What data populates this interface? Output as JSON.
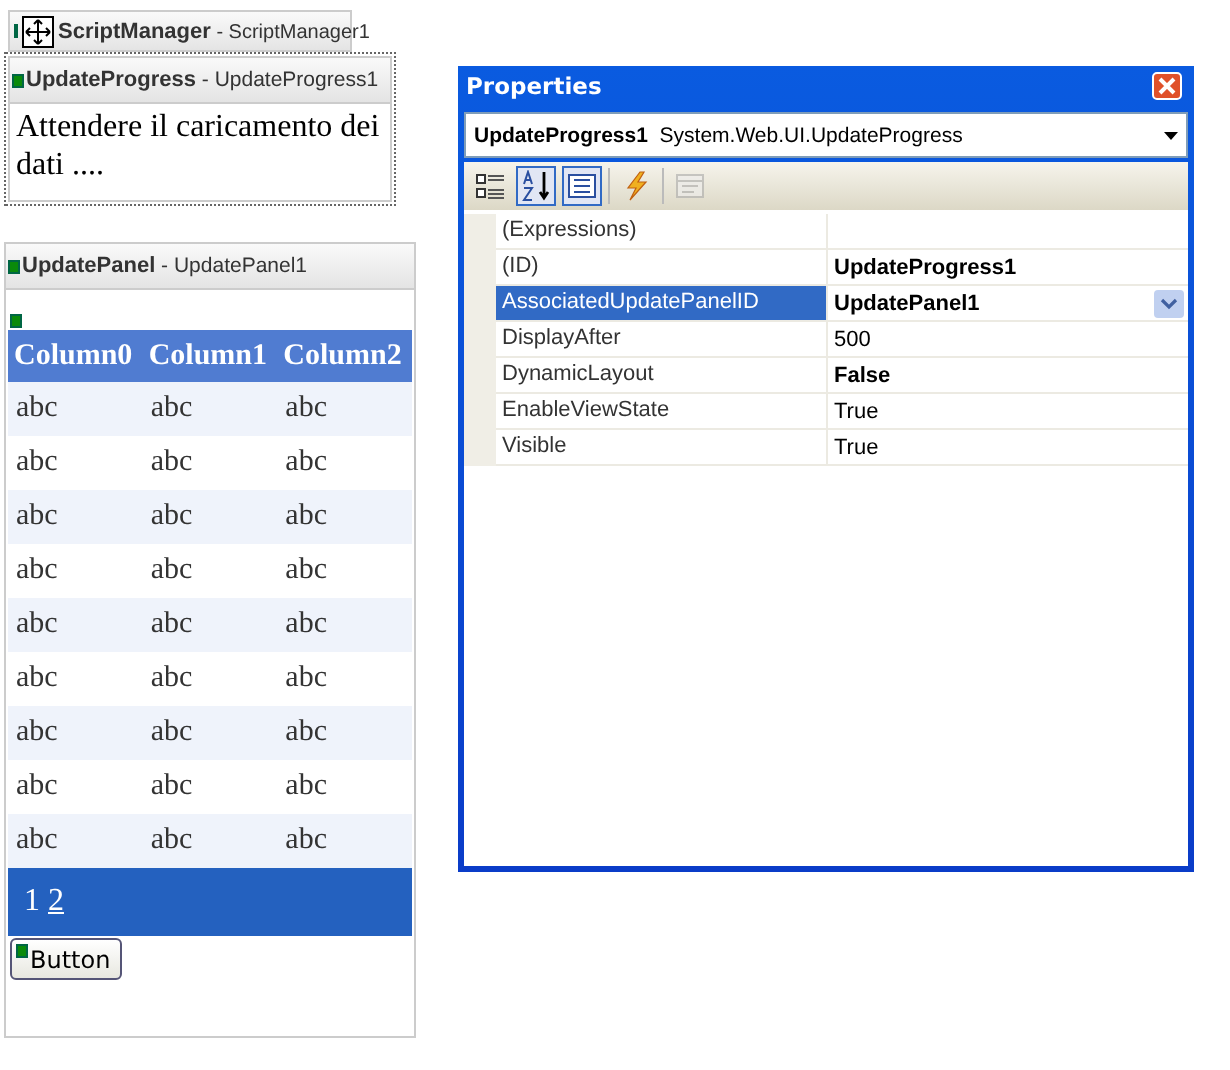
{
  "designer": {
    "script_manager": {
      "label": "**ScriptManager** - ScriptManager1"
    },
    "update_progress": {
      "label": "**UpdateProgress** - UpdateProgress1",
      "content": "Attendere il caricamento dei dati ...."
    },
    "update_panel": {
      "label": "**UpdatePanel** - UpdatePanel1",
      "grid": {
        "columns": [
          "Column0",
          "Column1",
          "Column2"
        ],
        "rows": [
          [
            "abc",
            "abc",
            "abc"
          ],
          [
            "abc",
            "abc",
            "abc"
          ],
          [
            "abc",
            "abc",
            "abc"
          ],
          [
            "abc",
            "abc",
            "abc"
          ],
          [
            "abc",
            "abc",
            "abc"
          ],
          [
            "abc",
            "abc",
            "abc"
          ],
          [
            "abc",
            "abc",
            "abc"
          ],
          [
            "abc",
            "abc",
            "abc"
          ],
          [
            "abc",
            "abc",
            "abc"
          ]
        ],
        "pages": [
          {
            "label": "1",
            "selected": true
          },
          {
            "label": "2",
            "selected": false
          }
        ]
      },
      "button": "Button"
    }
  },
  "properties": {
    "title": "Properties",
    "object_name": "UpdateProgress1",
    "object_type": "System.Web.UI.UpdateProgress",
    "toolbar": [
      {
        "kind": "categorized",
        "selected": false,
        "disabled": false
      },
      {
        "kind": "alphabetical",
        "selected": true,
        "disabled": false
      },
      {
        "kind": "properties",
        "selected": true,
        "disabled": false
      },
      {
        "kind": "events",
        "selected": false,
        "disabled": false
      },
      {
        "kind": "pages",
        "selected": false,
        "disabled": true
      }
    ],
    "rows": [
      {
        "name": "(Expressions)",
        "value": "",
        "bold": false,
        "selected": false
      },
      {
        "name": "(ID)",
        "value": "UpdateProgress1",
        "bold": true,
        "selected": false
      },
      {
        "name": "AssociatedUpdatePanelID",
        "value": "UpdatePanel1",
        "bold": true,
        "selected": true
      },
      {
        "name": "DisplayAfter",
        "value": "500",
        "bold": false,
        "selected": false
      },
      {
        "name": "DynamicLayout",
        "value": "False",
        "bold": true,
        "selected": false
      },
      {
        "name": "EnableViewState",
        "value": "True",
        "bold": false,
        "selected": false
      },
      {
        "name": "Visible",
        "value": "True",
        "bold": false,
        "selected": false
      }
    ]
  }
}
